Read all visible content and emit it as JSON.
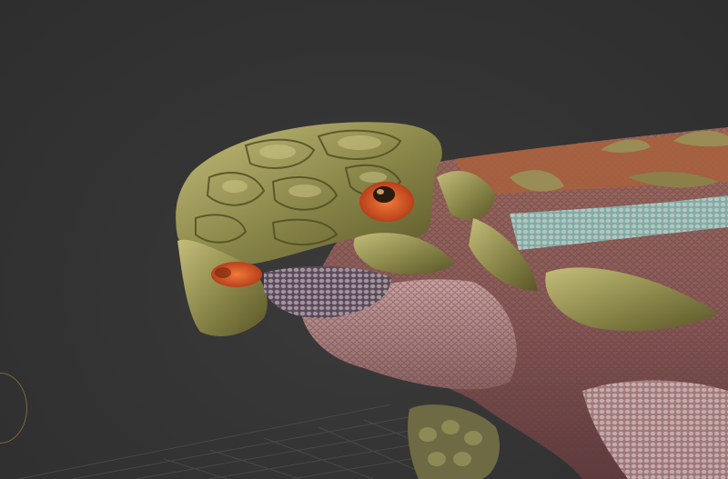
{
  "viewport": {
    "background_color": "#333333",
    "grid_color": "#4a4a4a",
    "model": {
      "subject": "ankylosaur-dinosaur-head",
      "colors": {
        "armor": "#7a7840",
        "armor_highlight": "#c4bd7a",
        "eye": "#d9531e",
        "skin": "#8a5a58",
        "skin_light": "#c8a0a0",
        "stripe": "#7fb5ad",
        "mouth": "#5a4a5a"
      }
    },
    "gizmo": {
      "icon": "rotation-ring-icon",
      "color": "#9a7a3a"
    }
  }
}
